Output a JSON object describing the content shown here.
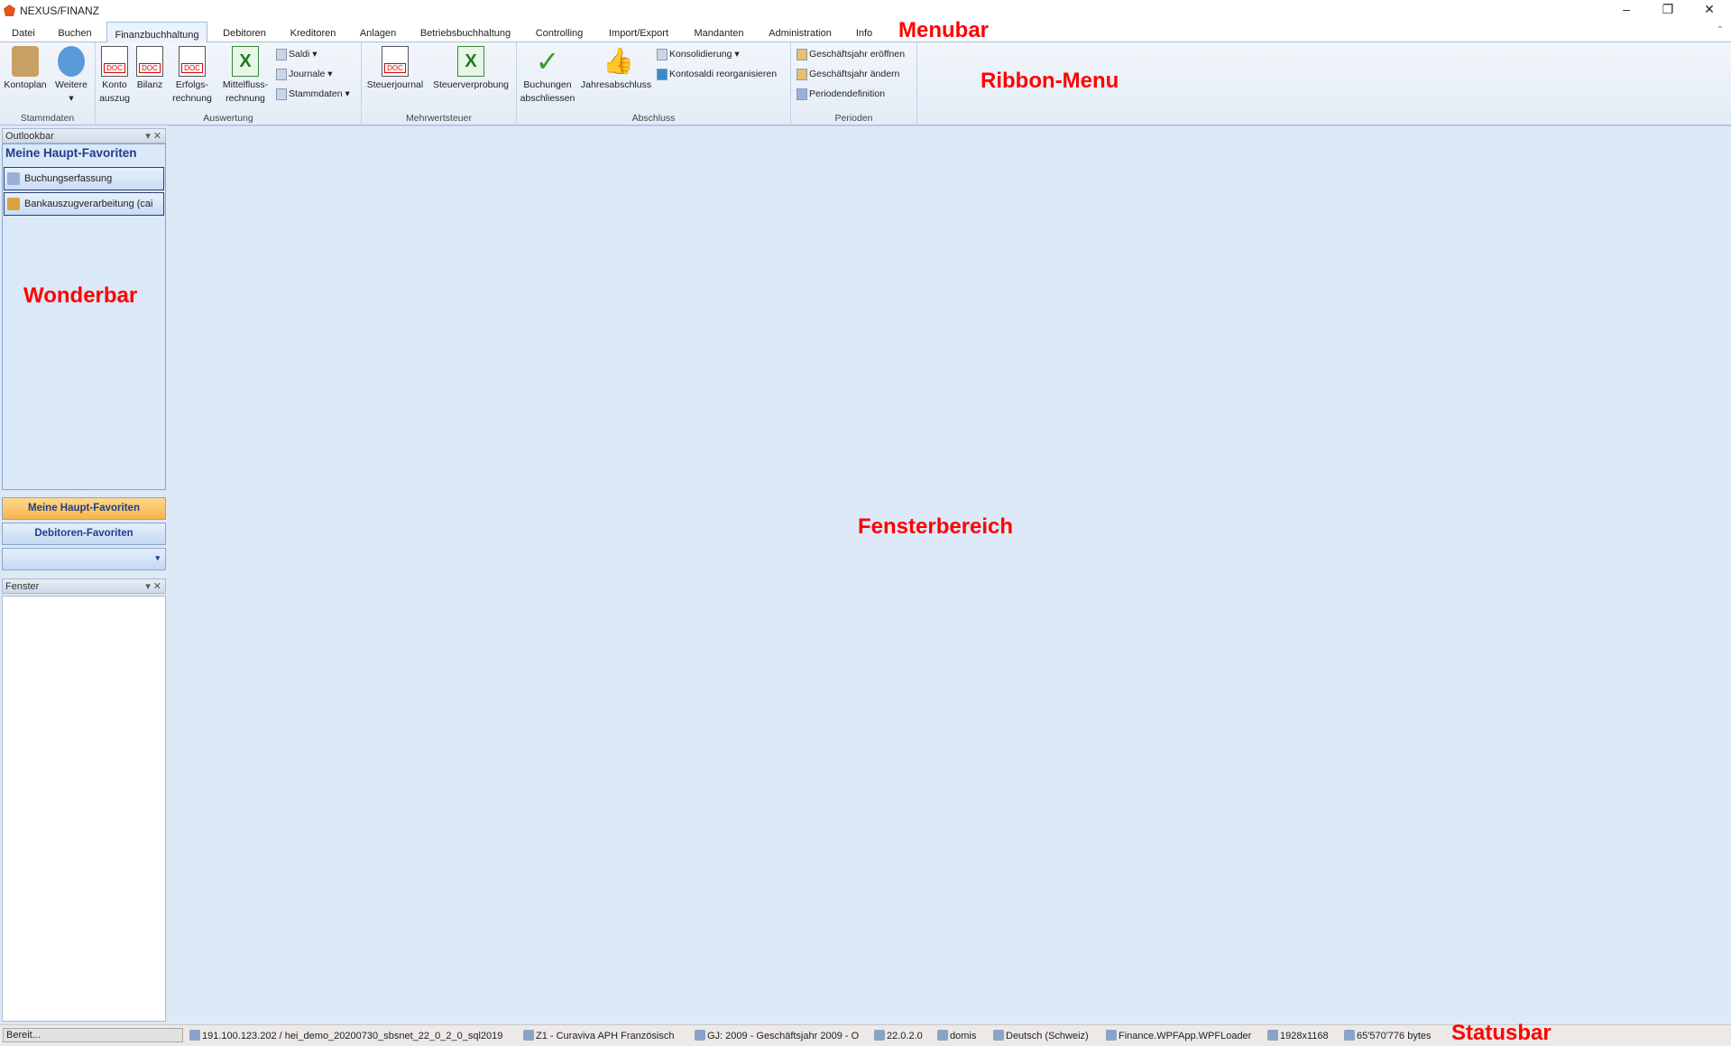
{
  "app_title": "NEXUS/FINANZ",
  "menu_tabs": [
    "Datei",
    "Buchen",
    "Finanzbuchhaltung",
    "Debitoren",
    "Kreditoren",
    "Anlagen",
    "Betriebsbuchhaltung",
    "Controlling",
    "Import/Export",
    "Mandanten",
    "Administration",
    "Info"
  ],
  "ribbon": {
    "stammdaten": {
      "label": "Stammdaten",
      "kontoplan": "Kontoplan",
      "weitere": "Weitere"
    },
    "auswertung": {
      "label": "Auswertung",
      "konto": "Konto auszug",
      "bilanz": "Bilanz",
      "erfolg": "Erfolgs- rechnung",
      "mittelfluss": "Mittelfluss- rechnung",
      "saldi": "Saldi",
      "journale": "Journale",
      "stammdaten": "Stammdaten"
    },
    "mwst": {
      "label": "Mehrwertsteuer",
      "steuerjournal": "Steuerjournal",
      "steuerverprobung": "Steuerverprobung"
    },
    "abschluss": {
      "label": "Abschluss",
      "buchungen": "Buchungen abschliessen",
      "jahres": "Jahresabschluss",
      "konsolidierung": "Konsolidierung",
      "kontosaldi": "Kontosaldi reorganisieren"
    },
    "perioden": {
      "label": "Perioden",
      "eroeffnen": "Geschäftsjahr eröffnen",
      "aendern": "Geschäftsjahr ändern",
      "definition": "Periodendefinition"
    }
  },
  "outlookbar": {
    "title": "Outlookbar",
    "header": "Meine Haupt-Favoriten",
    "items": [
      "Buchungserfassung",
      "Bankauszugverarbeitung (cai"
    ],
    "nav": [
      "Meine Haupt-Favoriten",
      "Debitoren-Favoriten"
    ]
  },
  "fenster": {
    "title": "Fenster"
  },
  "status": [
    "Bereit...",
    "191.100.123.202 / hei_demo_20200730_sbsnet_22_0_2_0_sql2019",
    "Z1 - Curaviva APH Französisch",
    "GJ: 2009 - Geschäftsjahr 2009 - O",
    "22.0.2.0",
    "domis",
    "Deutsch (Schweiz)",
    "Finance.WPFApp.WPFLoader",
    "1928x1168",
    "65'570'776 bytes"
  ],
  "annotations": {
    "menubar": "Menubar",
    "ribbon": "Ribbon-Menu",
    "wonderbar": "Wonderbar",
    "fenster": "Fensterbereich",
    "statusbar": "Statusbar"
  },
  "colors": {
    "annotation": "#ff0000",
    "selected_nav": "#f8b44a"
  }
}
